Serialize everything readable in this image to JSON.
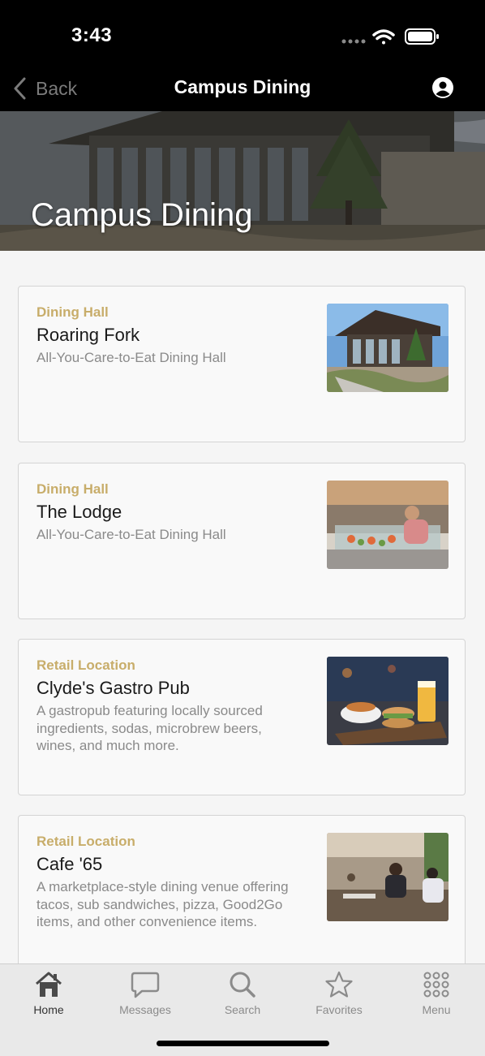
{
  "status": {
    "time": "3:43"
  },
  "nav": {
    "back_label": "Back",
    "title": "Campus Dining"
  },
  "hero": {
    "title": "Campus Dining"
  },
  "cards": [
    {
      "category": "Dining Hall",
      "title": "Roaring Fork",
      "description": "All-You-Care-to-Eat Dining Hall"
    },
    {
      "category": "Dining Hall",
      "title": "The Lodge",
      "description": "All-You-Care-to-Eat Dining Hall"
    },
    {
      "category": "Retail Location",
      "title": "Clyde's Gastro Pub",
      "description": "A gastropub featuring locally sourced ingredients, sodas, microbrew beers, wines, and much more."
    },
    {
      "category": "Retail Location",
      "title": "Cafe '65",
      "description": "A marketplace-style dining venue offering tacos, sub sandwiches, pizza, Good2Go items, and other convenience items."
    }
  ],
  "tabs": [
    {
      "label": "Home",
      "icon": "home-icon",
      "active": true
    },
    {
      "label": "Messages",
      "icon": "message-icon",
      "active": false
    },
    {
      "label": "Search",
      "icon": "search-icon",
      "active": false
    },
    {
      "label": "Favorites",
      "icon": "star-icon",
      "active": false
    },
    {
      "label": "Menu",
      "icon": "grid-icon",
      "active": false
    }
  ],
  "colors": {
    "accent": "#c8ad6a",
    "nav_bg": "#000000",
    "tab_bg": "#e9e9e9"
  }
}
